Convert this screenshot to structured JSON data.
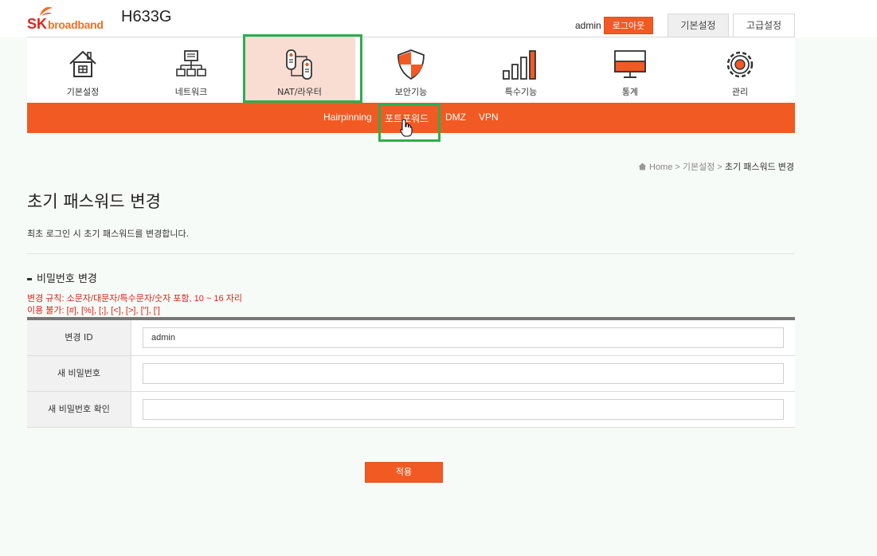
{
  "header": {
    "logo_text_sk": "SK",
    "logo_text_broadband": "broadband",
    "model": "H633G",
    "username": "admin",
    "logout_label": "로그아웃",
    "tab_basic": "기본설정",
    "tab_advanced": "고급설정"
  },
  "nav": {
    "items": [
      {
        "label": "기본설정",
        "icon": "house-icon"
      },
      {
        "label": "네트워크",
        "icon": "network-icon"
      },
      {
        "label": "NAT/라우터",
        "icon": "router-icon"
      },
      {
        "label": "보안기능",
        "icon": "shield-icon"
      },
      {
        "label": "특수기능",
        "icon": "bar-chart-icon"
      },
      {
        "label": "통계",
        "icon": "monitor-icon"
      },
      {
        "label": "관리",
        "icon": "gear-icon"
      }
    ],
    "active_index": 2
  },
  "subnav": {
    "items": [
      "Hairpinning",
      "포트포워드",
      "DMZ",
      "VPN"
    ]
  },
  "breadcrumb": {
    "home": "Home",
    "sep1": " > ",
    "level1": "기본설정",
    "sep2": " > ",
    "current": "초기 패스워드 변경"
  },
  "page": {
    "title": "초기 패스워드 변경",
    "description": "최초 로그인 시 초기 패스워드를 변경합니다."
  },
  "section": {
    "title": "비밀번호 변경",
    "rule1": "변경 규칙: 소문자/대문자/특수문자/숫자 포함, 10 ~ 16 자리",
    "rule2": "이용 불가: [#], [%], [;], [<], [>], [\"], [']"
  },
  "form": {
    "rows": [
      {
        "label": "변경 ID",
        "value": "admin"
      },
      {
        "label": "새 비밀번호",
        "value": ""
      },
      {
        "label": "새 비밀번호 확인",
        "value": ""
      }
    ]
  },
  "apply_label": "적용",
  "colors": {
    "accent": "#f15a22",
    "highlight": "#2fad4f",
    "active_nav_bg": "#f9ddd2",
    "rule_text": "#e2231a"
  }
}
